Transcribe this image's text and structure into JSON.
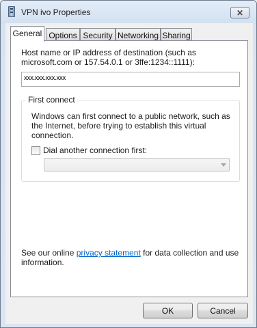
{
  "window": {
    "title": "VPN ivo Properties",
    "close_glyph": "✕"
  },
  "tabs": [
    {
      "label": "General",
      "active": true
    },
    {
      "label": "Options",
      "active": false
    },
    {
      "label": "Security",
      "active": false
    },
    {
      "label": "Networking",
      "active": false
    },
    {
      "label": "Sharing",
      "active": false
    }
  ],
  "general": {
    "host_label": "Host name or IP address of destination (such as microsoft.com or 157.54.0.1 or 3ffe:1234::1111):",
    "host_value": "xxx.xxx.xxx.xxx",
    "first_connect": {
      "legend": "First connect",
      "description": "Windows can first connect to a public network, such as the Internet, before trying to establish this virtual connection.",
      "dial_label": "Dial another connection first:",
      "dial_checked": false,
      "dial_select_value": ""
    },
    "privacy_prefix": "See our online ",
    "privacy_link": "privacy statement",
    "privacy_suffix": " for data collection and use information."
  },
  "buttons": {
    "ok": "OK",
    "cancel": "Cancel"
  },
  "icons": {
    "title": "vpn-connection-icon",
    "close": "close-icon",
    "dropdown": "chevron-down-icon"
  }
}
